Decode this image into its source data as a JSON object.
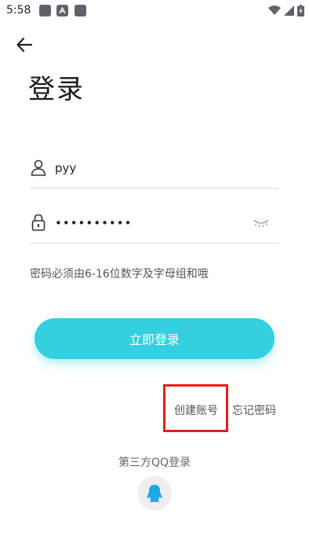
{
  "status_bar": {
    "time": "5:58",
    "app_icon_letter": "A"
  },
  "header": {
    "title": "登录"
  },
  "form": {
    "username_value": "pyy",
    "password_value": "••••••••••",
    "password_hint": "密码必须由6-16位数字及字母组和哦"
  },
  "actions": {
    "login_label": "立即登录",
    "create_account_label": "创建账号",
    "forgot_password_label": "忘记密码"
  },
  "third_party": {
    "label": "第三方QQ登录"
  },
  "colors": {
    "accent": "#34cfe0",
    "highlight_box": "#e0201b"
  },
  "icons": {
    "back": "back-arrow-icon",
    "user": "user-icon",
    "lock": "lock-icon",
    "eye": "eye-closed-icon",
    "qq": "qq-icon"
  }
}
